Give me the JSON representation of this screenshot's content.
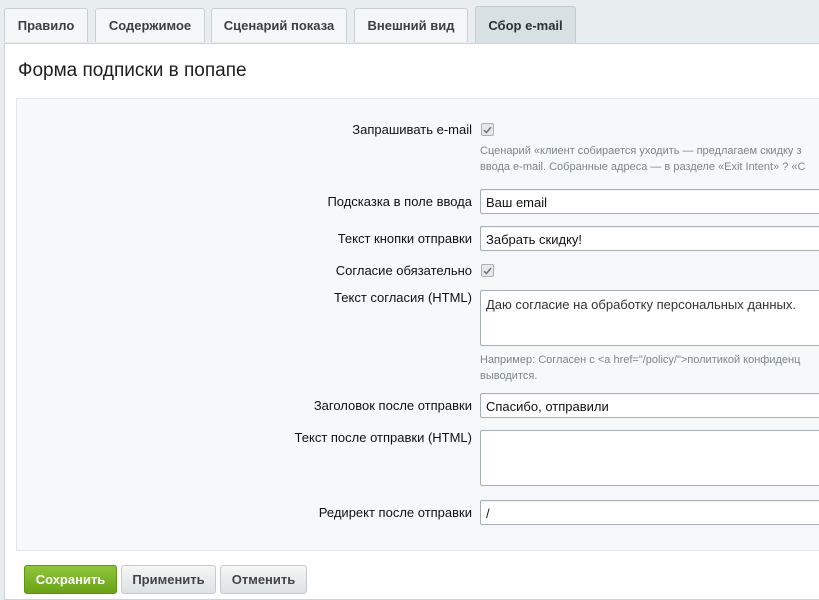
{
  "tabs": [
    {
      "label": "Правило"
    },
    {
      "label": "Содержимое"
    },
    {
      "label": "Сценарий показа"
    },
    {
      "label": "Внешний вид"
    },
    {
      "label": "Сбор e-mail",
      "active": true
    }
  ],
  "section_title": "Форма подписки в попапе",
  "form": {
    "ask_email": {
      "label": "Запрашивать e-mail",
      "checked": true,
      "hint_line1": "Сценарий «клиент собирается уходить — предлагаем скидку з",
      "hint_line2": "ввода e-mail. Собранные адреса — в разделе «Exit Intent» ? «С"
    },
    "placeholder": {
      "label": "Подсказка в поле ввода",
      "value": "Ваш email"
    },
    "button_text": {
      "label": "Текст кнопки отправки",
      "value": "Забрать скидку!"
    },
    "consent_required": {
      "label": "Согласие обязательно",
      "checked": true
    },
    "consent_text": {
      "label": "Текст согласия (HTML)",
      "value": "Даю согласие на обработку персональных данных.",
      "hint_line1": "Например: Согласен с <a href=\"/policy/\">политикой конфиденц",
      "hint_line2": "выводится."
    },
    "success_title": {
      "label": "Заголовок после отправки",
      "value": "Спасибо, отправили"
    },
    "success_text": {
      "label": "Текст после отправки (HTML)",
      "value": ""
    },
    "redirect": {
      "label": "Редирект после отправки",
      "value": "/"
    }
  },
  "buttons": {
    "save": "Сохранить",
    "apply": "Применить",
    "cancel": "Отменить"
  },
  "colors": {
    "save_button": "#7ab327",
    "active_tab": "#d7e0e3",
    "background": "#e8edef"
  }
}
